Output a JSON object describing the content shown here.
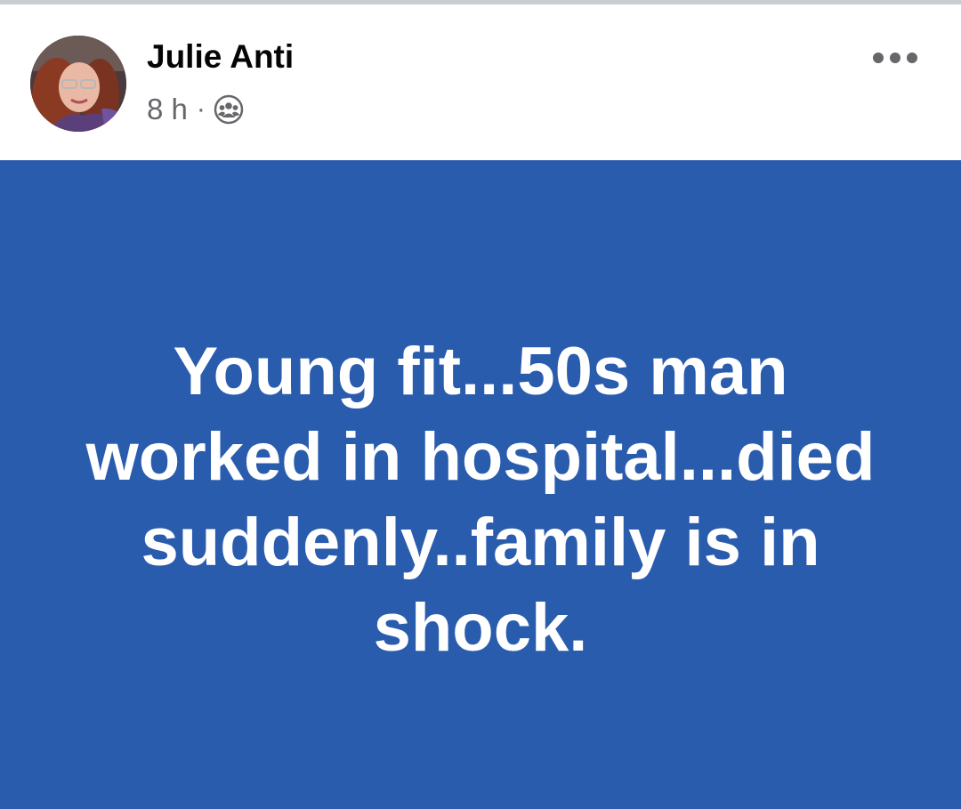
{
  "post": {
    "author": "Julie Anti",
    "time": "8 h",
    "separator": "·",
    "audience_icon": "friends-icon",
    "more_icon": "more-options-icon",
    "text_lines": [
      "Young fit...50s man",
      "worked in hospital...died",
      "suddenly..family is in",
      "shock."
    ]
  },
  "colors": {
    "post_background": "#2a5cae",
    "post_text": "#ffffff",
    "name": "#050505",
    "meta": "#65676b"
  }
}
